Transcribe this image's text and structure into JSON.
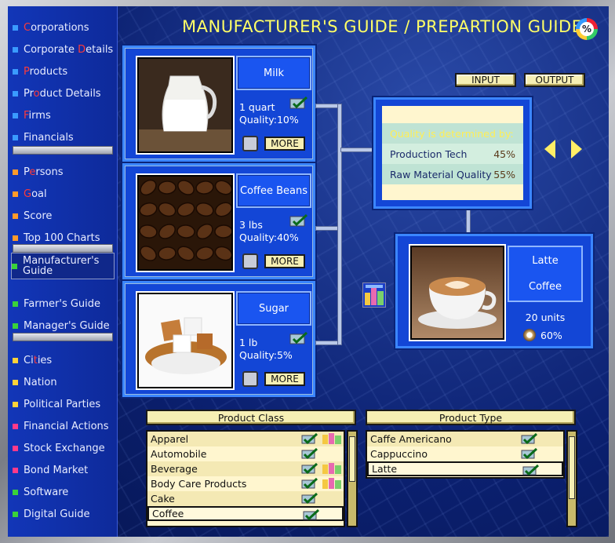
{
  "header": {
    "title": "MANUFACTURER'S GUIDE / PREPARTION GUIDE",
    "pct_symbol": "%"
  },
  "sidebar": {
    "groups": [
      [
        {
          "pre": "",
          "hl": "C",
          "post": "orporations",
          "color": "#3a9bff"
        },
        {
          "pre": "Corporate ",
          "hl": "D",
          "post": "etails",
          "color": "#3a9bff"
        },
        {
          "pre": "",
          "hl": "P",
          "post": "roducts",
          "color": "#3a9bff"
        },
        {
          "pre": "Pr",
          "hl": "o",
          "post": "duct Details",
          "color": "#3a9bff"
        },
        {
          "pre": "",
          "hl": "F",
          "post": "irms",
          "color": "#3a9bff"
        },
        {
          "pre": "Financials",
          "hl": "",
          "post": "",
          "color": "#3a9bff"
        }
      ],
      [
        {
          "pre": "P",
          "hl": "e",
          "post": "rsons",
          "color": "#ff9a2a"
        },
        {
          "pre": "",
          "hl": "G",
          "post": "oal",
          "color": "#ff9a2a"
        },
        {
          "pre": "Score",
          "hl": "",
          "post": "",
          "color": "#ff9a2a"
        },
        {
          "pre": "Top 100 Charts",
          "hl": "",
          "post": "",
          "color": "#ff9a2a"
        }
      ],
      [
        {
          "pre": "Manufacturer's Guide",
          "hl": "",
          "post": "",
          "color": "#3ad23a",
          "selected": true
        },
        {
          "pre": "Farmer's Guide",
          "hl": "",
          "post": "",
          "color": "#3ad23a"
        },
        {
          "pre": "Manager's Guide",
          "hl": "",
          "post": "",
          "color": "#3ad23a"
        }
      ],
      [
        {
          "pre": "Ci",
          "hl": "t",
          "post": "ies",
          "color": "#ffd23a"
        },
        {
          "pre": "Nation",
          "hl": "",
          "post": "",
          "color": "#ffd23a"
        },
        {
          "pre": "Political Parties",
          "hl": "",
          "post": "",
          "color": "#ffd23a"
        },
        {
          "pre": "Financial Actions",
          "hl": "",
          "post": "",
          "color": "#ff3a8a"
        },
        {
          "pre": "Stock Exchange",
          "hl": "",
          "post": "",
          "color": "#ff3a8a"
        },
        {
          "pre": "Bond Market",
          "hl": "",
          "post": "",
          "color": "#ff3a8a"
        },
        {
          "pre": "Software",
          "hl": "",
          "post": "",
          "color": "#3ad23a"
        },
        {
          "pre": "Digital Guide",
          "hl": "",
          "post": "",
          "color": "#3ad23a"
        }
      ]
    ]
  },
  "toolbar": {
    "input_label": "INPUT",
    "output_label": "OUTPUT"
  },
  "ingredients": [
    {
      "name": "Milk",
      "qty": "1 quart",
      "quality": "Quality:10%",
      "more": "MORE",
      "photo": "milk"
    },
    {
      "name": "Coffee Beans",
      "qty": "3 lbs",
      "quality": "Quality:40%",
      "more": "MORE",
      "photo": "beans"
    },
    {
      "name": "Sugar",
      "qty": "1 lb",
      "quality": "Quality:5%",
      "more": "MORE",
      "photo": "sugar"
    }
  ],
  "quality_box": {
    "heading": "Quality is determined by:",
    "rows": [
      {
        "label": "Production Tech",
        "value": "45%"
      },
      {
        "label": "Raw Material Quality",
        "value": "55%"
      }
    ]
  },
  "output": {
    "name_line1": "Latte",
    "name_line2": "Coffee",
    "units": "20 units",
    "quality": "60%"
  },
  "product_class": {
    "header": "Product Class",
    "items": [
      {
        "label": "Apparel",
        "bld": true
      },
      {
        "label": "Automobile",
        "bld": false
      },
      {
        "label": "Beverage",
        "bld": true
      },
      {
        "label": "Body Care Products",
        "bld": true
      },
      {
        "label": "Cake",
        "bld": false
      },
      {
        "label": "Coffee",
        "bld": false,
        "selected": true
      }
    ]
  },
  "product_type": {
    "header": "Product Type",
    "items": [
      {
        "label": "Caffe Americano"
      },
      {
        "label": "Cappuccino"
      },
      {
        "label": "Latte",
        "selected": true
      }
    ]
  }
}
